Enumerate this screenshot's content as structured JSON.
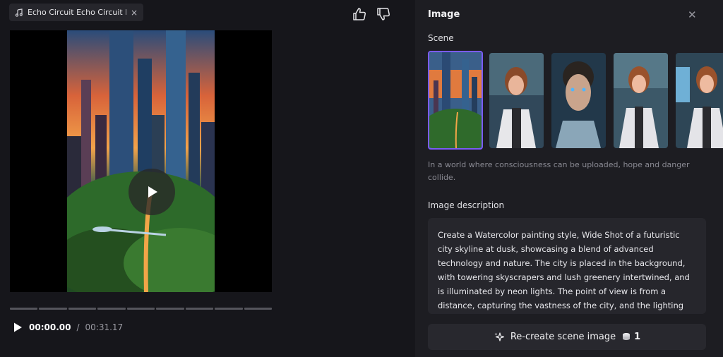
{
  "track": {
    "title": "Echo Circuit Echo Circuit Ech",
    "close_glyph": "×",
    "icon": "music-note-icon"
  },
  "feedback": {
    "like_icon": "thumbs-up-icon",
    "dislike_icon": "thumbs-down-icon"
  },
  "player": {
    "current_time": "00:00.00",
    "separator": "/",
    "duration": "00:31.17",
    "segments": 9
  },
  "panel": {
    "title": "Image",
    "close_glyph": "✕",
    "scene_label": "Scene",
    "scene_caption": "In a world where consciousness can be uploaded, hope and danger collide.",
    "description_label": "Image description",
    "description": "Create a Watercolor painting style, Wide Shot of a futuristic city skyline at dusk, showcasing a blend of advanced technology and nature. The city is placed in the background, with towering skyscrapers and lush greenery intertwined, and is illuminated by neon lights. The point of view is from a distance, capturing the vastness of the city, and the lighting should be a mix of warm sunset hues and cool neon glows. The mood of the scene is a",
    "recreate_label": "Re-create scene image",
    "cost": "1"
  },
  "colors": {
    "accent": "#7b5cf5",
    "bg": "#16161b",
    "panel": "#1d1d22"
  }
}
